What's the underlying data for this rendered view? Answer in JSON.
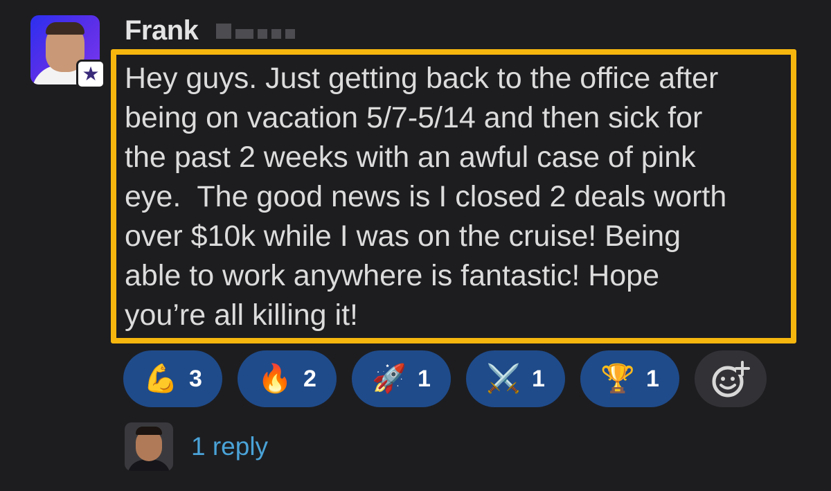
{
  "message": {
    "author": "Frank",
    "text": "Hey guys. Just getting back to the office after\nbeing on vacation 5/7-5/14 and then sick for\nthe past 2 weeks with an awful case of pink\neye.  The good news is I closed 2 deals worth\nover $10k while I was on the cruise! Being\nable to work anywhere is fantastic! Hope\nyou’re all killing it!",
    "author_badge_icon": "star-badge-icon",
    "highlight_color": "#f6b60e"
  },
  "reactions": [
    {
      "icon": "flexed-biceps-icon",
      "emoji": "💪",
      "count": "3"
    },
    {
      "icon": "fire-icon",
      "emoji": "🔥",
      "count": "2"
    },
    {
      "icon": "rocket-icon",
      "emoji": "🚀",
      "count": "1"
    },
    {
      "icon": "crossed-swords-icon",
      "emoji": "⚔️",
      "count": "1"
    },
    {
      "icon": "trophy-icon",
      "emoji": "🏆",
      "count": "1"
    }
  ],
  "add_reaction": {
    "icon": "add-emoji-icon"
  },
  "thread": {
    "reply_label": "1 reply"
  },
  "colors": {
    "background": "#1d1d20",
    "reaction_bg": "#1f4b8a",
    "link": "#4aa3d8"
  }
}
